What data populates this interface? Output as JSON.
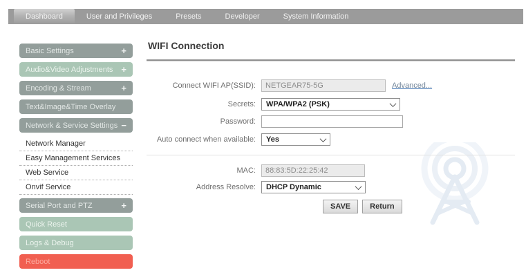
{
  "nav": {
    "tabs": [
      {
        "label": "Dashboard",
        "active": true
      },
      {
        "label": "User and Privileges",
        "active": false
      },
      {
        "label": "Presets",
        "active": false
      },
      {
        "label": "Developer",
        "active": false
      },
      {
        "label": "System Information",
        "active": false
      }
    ]
  },
  "sidebar": {
    "items": [
      {
        "label": "Basic Settings",
        "toggle": "+",
        "variant": "gray",
        "type": "group"
      },
      {
        "label": "Audio&Video Adjustments",
        "toggle": "+",
        "variant": "mint",
        "type": "group"
      },
      {
        "label": "Encoding & Stream",
        "toggle": "+",
        "variant": "gray",
        "type": "group"
      },
      {
        "label": "Text&Image&Time Overlay",
        "toggle": "",
        "variant": "gray",
        "type": "group"
      },
      {
        "label": "Network & Service Settings",
        "toggle": "−",
        "variant": "gray",
        "type": "group"
      },
      {
        "label": "Network Manager",
        "type": "sub"
      },
      {
        "label": "Easy Management Services",
        "type": "sub"
      },
      {
        "label": "Web Service",
        "type": "sub"
      },
      {
        "label": "Onvif Service",
        "type": "sub"
      },
      {
        "label": "Serial Port and PTZ",
        "toggle": "+",
        "variant": "gray",
        "type": "group"
      },
      {
        "label": "Quick Reset",
        "toggle": "",
        "variant": "mint",
        "type": "group"
      },
      {
        "label": "Logs & Debug",
        "toggle": "",
        "variant": "mint",
        "type": "group"
      },
      {
        "label": "Reboot",
        "toggle": "",
        "variant": "red",
        "type": "group"
      }
    ]
  },
  "main": {
    "title": "WIFI Connection",
    "form": {
      "ssid": {
        "label": "Connect WIFI AP(SSID):",
        "value": "NETGEAR75-5G",
        "link": "Advanced..."
      },
      "secrets": {
        "label": "Secrets:",
        "value": "WPA/WPA2 (PSK)"
      },
      "password": {
        "label": "Password:",
        "value": "",
        "placeholder": ""
      },
      "auto_connect": {
        "label": "Auto connect when available:",
        "value": "Yes"
      },
      "mac": {
        "label": "MAC:",
        "value": "88:83:5D:22:25:42"
      },
      "address_resolve": {
        "label": "Address Resolve:",
        "value": "DHCP Dynamic"
      }
    },
    "buttons": {
      "save": "SAVE",
      "return": "Return"
    }
  },
  "icons": {
    "watermark": "antenna-tower-icon",
    "select_arrow": "chevron-down-icon",
    "expand": "plus-icon",
    "collapse": "minus-icon"
  },
  "colors": {
    "nav_bar": "#9b9b9b",
    "sidebar_gray": "#939e9b",
    "sidebar_mint": "#aac6b5",
    "sidebar_red": "#f15f51",
    "link_blue": "#4d7eb8",
    "readonly_field_bg": "#ebebeb"
  }
}
